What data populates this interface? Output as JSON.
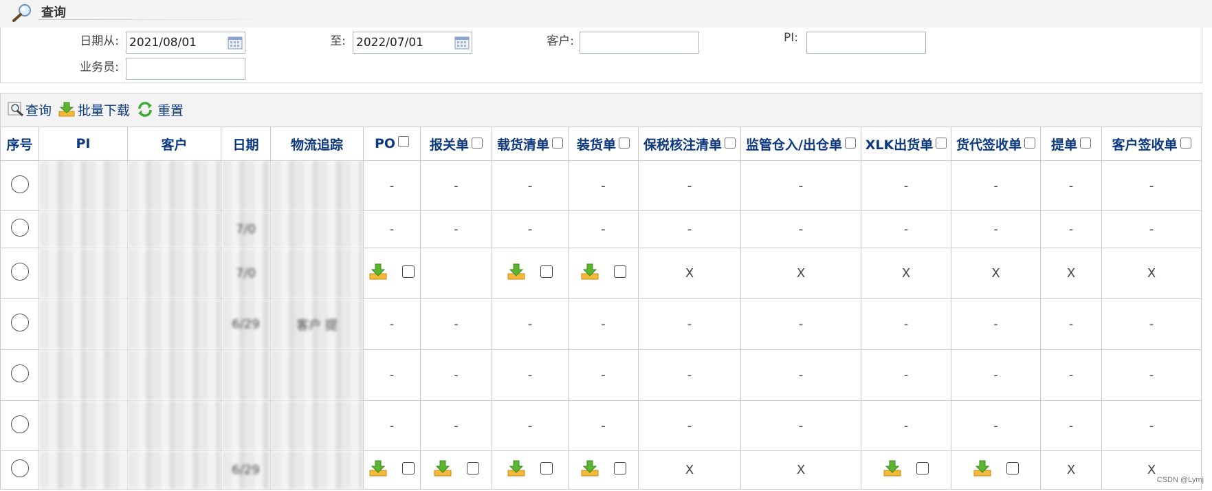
{
  "titlebar": {
    "title": "查询",
    "icon": "magnifier-icon"
  },
  "form": {
    "date_from_label": "日期从:",
    "date_from_value": "2021/08/01",
    "date_to_label": "至:",
    "date_to_value": "2022/07/01",
    "customer_label": "客户:",
    "customer_value": "",
    "pi_label": "PI:",
    "pi_value": "",
    "salesperson_label": "业务员:",
    "salesperson_value": ""
  },
  "toolbar": {
    "query_label": "查询",
    "batch_download_label": "批量下载",
    "reset_label": "重置"
  },
  "table": {
    "headers": [
      "序号",
      "PI",
      "客户",
      "日期",
      "物流追踪",
      "PO",
      "报关单",
      "载货清单",
      "装货单",
      "保税核注清单",
      "监管仓入/出仓单",
      "XLK出货单",
      "货代签收单",
      "提单",
      "客户签收单"
    ],
    "rows": [
      {
        "date": "",
        "tracking": "",
        "cells": [
          "-",
          "-",
          "-",
          "-",
          "-",
          "-",
          "-",
          "-",
          "-",
          "-"
        ]
      },
      {
        "date": "7/0",
        "tracking": "",
        "cells": [
          "-",
          "-",
          "-",
          "-",
          "-",
          "-",
          "-",
          "-",
          "-",
          "-"
        ]
      },
      {
        "date": "7/0",
        "tracking": "",
        "cells": [
          "dl",
          "",
          "dl",
          "dl",
          "X",
          "X",
          "X",
          "X",
          "X",
          "X"
        ]
      },
      {
        "date": "6/29",
        "tracking": "客户 提",
        "cells": [
          "-",
          "-",
          "-",
          "-",
          "-",
          "-",
          "-",
          "-",
          "-",
          "-"
        ]
      },
      {
        "date": "",
        "tracking": "",
        "cells": [
          "-",
          "-",
          "-",
          "-",
          "-",
          "-",
          "-",
          "-",
          "-",
          "-"
        ]
      },
      {
        "date": "",
        "tracking": "",
        "cells": [
          "-",
          "-",
          "-",
          "-",
          "-",
          "-",
          "-",
          "-",
          "-",
          "-"
        ]
      },
      {
        "date": "6/29",
        "tracking": "",
        "cells": [
          "dl",
          "dl",
          "dl",
          "dl",
          "X",
          "X",
          "dl",
          "dl",
          "X",
          "X"
        ]
      }
    ],
    "partial_texts": {
      "row1_pi": "1",
      "row3_pi": "P(",
      "row5_customer": "D M",
      "row7_customer": "Labs S"
    }
  },
  "watermark": "CSDN @Lymj"
}
